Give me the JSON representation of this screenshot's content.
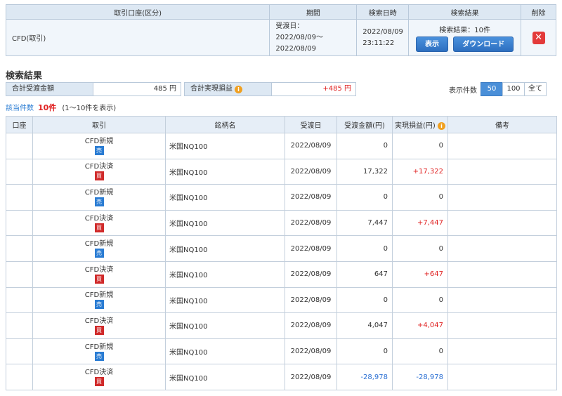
{
  "condition": {
    "headers": [
      "取引口座(区分)",
      "期間",
      "検索日時",
      "検索結果",
      "削除"
    ],
    "account": "CFD(取引)",
    "period_label": "受渡日：",
    "period_range": "2022/08/09〜2022/08/09",
    "search_date": "2022/08/09",
    "search_time": "23:11:22",
    "result_label": "検索結果：10件",
    "show_button": "表示",
    "download_button": "ダウンロード",
    "delete_icon": "close-icon"
  },
  "section_title": "検索結果",
  "summary": {
    "settlement_label": "合計受渡金額",
    "settlement_value": "485 円",
    "profit_label": "合計実現損益",
    "profit_value": "+485 円"
  },
  "per_page": {
    "label": "表示件数",
    "options": [
      "50",
      "100",
      "全て"
    ],
    "selected": "50"
  },
  "count": {
    "label": "該当件数",
    "value": "10件",
    "range": "(1〜10件を表示)"
  },
  "table": {
    "headers": [
      "口座",
      "取引",
      "銘柄名",
      "受渡日",
      "受渡金額(円)",
      "実現損益(円)",
      "備考"
    ],
    "rows": [
      {
        "account": "",
        "type": "CFD新規",
        "side": "売",
        "name": "米国NQ100",
        "date": "2022/08/09",
        "amount": "0",
        "profit": "0",
        "note": ""
      },
      {
        "account": "",
        "type": "CFD決済",
        "side": "買",
        "name": "米国NQ100",
        "date": "2022/08/09",
        "amount": "17,322",
        "profit": "+17,322",
        "note": ""
      },
      {
        "account": "",
        "type": "CFD新規",
        "side": "売",
        "name": "米国NQ100",
        "date": "2022/08/09",
        "amount": "0",
        "profit": "0",
        "note": ""
      },
      {
        "account": "",
        "type": "CFD決済",
        "side": "買",
        "name": "米国NQ100",
        "date": "2022/08/09",
        "amount": "7,447",
        "profit": "+7,447",
        "note": ""
      },
      {
        "account": "",
        "type": "CFD新規",
        "side": "売",
        "name": "米国NQ100",
        "date": "2022/08/09",
        "amount": "0",
        "profit": "0",
        "note": ""
      },
      {
        "account": "",
        "type": "CFD決済",
        "side": "買",
        "name": "米国NQ100",
        "date": "2022/08/09",
        "amount": "647",
        "profit": "+647",
        "note": ""
      },
      {
        "account": "",
        "type": "CFD新規",
        "side": "売",
        "name": "米国NQ100",
        "date": "2022/08/09",
        "amount": "0",
        "profit": "0",
        "note": ""
      },
      {
        "account": "",
        "type": "CFD決済",
        "side": "買",
        "name": "米国NQ100",
        "date": "2022/08/09",
        "amount": "4,047",
        "profit": "+4,047",
        "note": ""
      },
      {
        "account": "",
        "type": "CFD新規",
        "side": "売",
        "name": "米国NQ100",
        "date": "2022/08/09",
        "amount": "0",
        "profit": "0",
        "note": ""
      },
      {
        "account": "",
        "type": "CFD決済",
        "side": "買",
        "name": "米国NQ100",
        "date": "2022/08/09",
        "amount": "-28,978",
        "profit": "-28,978",
        "note": ""
      }
    ]
  },
  "colors": {
    "header_bg": "#dde8f3",
    "accent_blue": "#2a7cd3",
    "positive_red": "#e02020",
    "negative_blue": "#2a6fd3"
  }
}
